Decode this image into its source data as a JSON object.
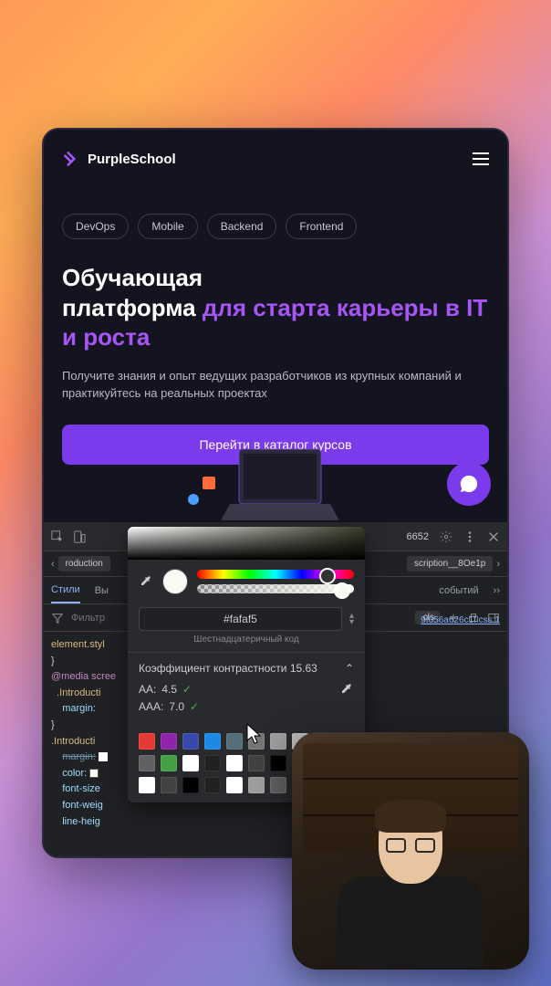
{
  "site": {
    "brand": "PurpleSchool",
    "tags": [
      "DevOps",
      "Mobile",
      "Backend",
      "Frontend"
    ],
    "hero_title_line1": "Обучающая",
    "hero_title_line2": "платформа",
    "hero_title_accent": "для старта карьеры в IT и роста",
    "subtitle": "Получите знания и опыт ведущих разработчиков из крупных компаний и практикуйтесь на реальных проектах",
    "cta": "Перейти в каталог курсов"
  },
  "devtools": {
    "toolbar_number": "6652",
    "breadcrumb_left": "roduction",
    "breadcrumb_right": "scription__8Oe1p",
    "tabs": {
      "styles": "Стили",
      "computed": "Вы",
      "events": "событий"
    },
    "filter_label": "Фильтр",
    "cls": ".cls",
    "source_link": "9f056a626c1f.css:1",
    "code": {
      "l1": "element.styl",
      "l2": "}",
      "media": "@media scree",
      "sel1": ".Introducti",
      "prop1": "margin:",
      "l5": "}",
      "sel2": ".Introducti",
      "prop_margin": "margin:",
      "prop_color": "color:",
      "prop_fs": "font-size",
      "prop_fw": "font-weig",
      "prop_lh": "line-heig"
    }
  },
  "picker": {
    "hex_value": "#fafaf5",
    "hex_label": "Шестнадцатеричный код",
    "contrast_label": "Коэффициент контрастности",
    "contrast_value": "15.63",
    "aa_label": "AA:",
    "aa_value": "4.5",
    "aaa_label": "AAA:",
    "aaa_value": "7.0",
    "swatches": [
      "#e53935",
      "#8e24aa",
      "#3949ab",
      "#1e88e5",
      "#546e7a",
      "#757575",
      "#9e9e9e",
      "#bdbdbd",
      "#616161",
      "#43a047",
      "#ffffff",
      "#212121",
      "#ffffff",
      "#424242",
      "#000000",
      "#303030",
      "#ffffff",
      "#424242",
      "#000000",
      "#212121",
      "#ffffff",
      "#9e9e9e",
      "#616161",
      "#000000"
    ]
  }
}
